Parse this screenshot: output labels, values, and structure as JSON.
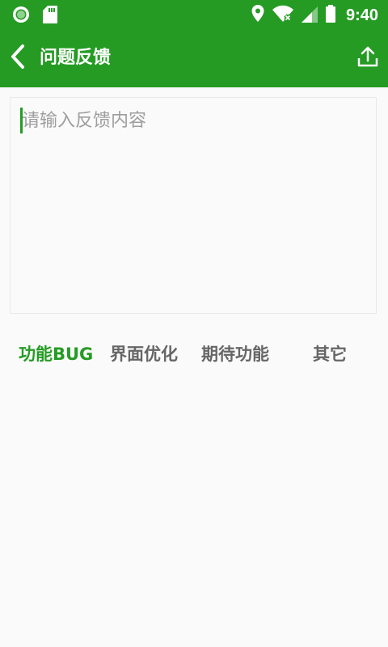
{
  "status_bar": {
    "time": "9:40",
    "icons": [
      "record-icon",
      "sd-card-icon",
      "location-icon",
      "wifi-icon",
      "cell-signal-icon",
      "battery-icon"
    ]
  },
  "app_bar": {
    "title": "问题反馈",
    "back_icon": "back-arrow-icon",
    "share_icon": "share-upload-icon",
    "color": "#259b24"
  },
  "feedback": {
    "value": "",
    "placeholder": "请输入反馈内容"
  },
  "categories": {
    "items": [
      {
        "label": "功能BUG",
        "selected": true
      },
      {
        "label": "界面优化",
        "selected": false
      },
      {
        "label": "期待功能",
        "selected": false
      },
      {
        "label": "其它",
        "selected": false
      }
    ],
    "active_color": "#259b24",
    "inactive_color": "#666666"
  }
}
